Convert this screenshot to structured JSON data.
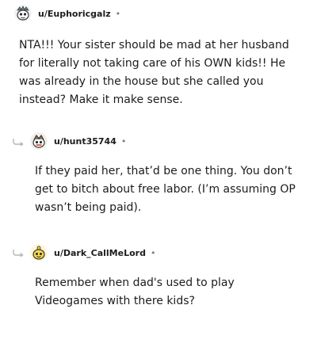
{
  "comments": [
    {
      "username": "u/Euphoricgalz",
      "separator": "•",
      "body": "NTA!!! Your sister should be mad at her husband for literally not taking care of his OWN kids!! He was already in the house but she called you instead? Make it make sense.",
      "avatar_icon": "snoo-avatar-icon"
    },
    {
      "username": "u/hunt35744",
      "separator": "•",
      "body": "If they paid her, that’d be one thing. You don’t get to bitch about free labor. (I’m assuming OP wasn’t being paid).",
      "avatar_icon": "snoo-avatar-icon",
      "reply_icon": "reply-arrow-icon"
    },
    {
      "username": "u/Dark_CallMeLord",
      "separator": "•",
      "body": "Remember when dad's used to play Videogames with there kids?",
      "avatar_icon": "snoo-avatar-icon",
      "reply_icon": "reply-arrow-icon"
    }
  ],
  "colors": {
    "text": "#1c1c1c",
    "meta": "#7c7c7c",
    "reply_arrow": "#b3b6b9"
  }
}
